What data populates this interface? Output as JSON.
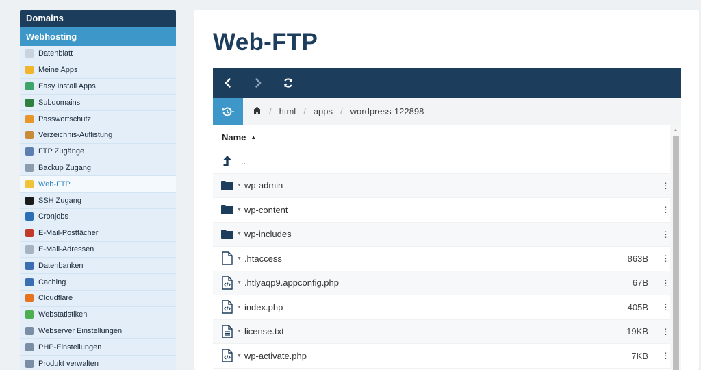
{
  "sidebar": {
    "header": "Domains",
    "section": "Webhosting",
    "items": [
      {
        "label": "Datenblatt",
        "icon": "document-icon",
        "color": "#c9d3de"
      },
      {
        "label": "Meine Apps",
        "icon": "apps-icon",
        "color": "#f0b52a"
      },
      {
        "label": "Easy Install Apps",
        "icon": "install-icon",
        "color": "#3da46a"
      },
      {
        "label": "Subdomains",
        "icon": "globe-icon",
        "color": "#2f7f3f"
      },
      {
        "label": "Passwortschutz",
        "icon": "key-icon",
        "color": "#e8962a"
      },
      {
        "label": "Verzeichnis-Auflistung",
        "icon": "folder-open-icon",
        "color": "#c98b3a"
      },
      {
        "label": "FTP Zugänge",
        "icon": "ftp-icon",
        "color": "#5a7fb0"
      },
      {
        "label": "Backup Zugang",
        "icon": "backup-icon",
        "color": "#8b9cb0"
      },
      {
        "label": "Web-FTP",
        "icon": "folder-icon",
        "color": "#f0c43a"
      },
      {
        "label": "SSH Zugang",
        "icon": "terminal-icon",
        "color": "#1a1a1a"
      },
      {
        "label": "Cronjobs",
        "icon": "clock-icon",
        "color": "#2a6fb5"
      },
      {
        "label": "E-Mail-Postfächer",
        "icon": "mailbox-icon",
        "color": "#c0392b"
      },
      {
        "label": "E-Mail-Adressen",
        "icon": "envelope-icon",
        "color": "#a6b3c2"
      },
      {
        "label": "Datenbanken",
        "icon": "database-icon",
        "color": "#3b6db3"
      },
      {
        "label": "Caching",
        "icon": "cache-icon",
        "color": "#3b6db3"
      },
      {
        "label": "Cloudflare",
        "icon": "cloudflare-icon",
        "color": "#e8731f"
      },
      {
        "label": "Webstatistiken",
        "icon": "chart-icon",
        "color": "#4caf50"
      },
      {
        "label": "Webserver Einstellungen",
        "icon": "gears-icon",
        "color": "#7a8fa6"
      },
      {
        "label": "PHP-Einstellungen",
        "icon": "gears-icon",
        "color": "#7a8fa6"
      },
      {
        "label": "Produkt verwalten",
        "icon": "gears-icon",
        "color": "#7a8fa6"
      }
    ],
    "active_index": 8
  },
  "main": {
    "title": "Web-FTP",
    "breadcrumb": [
      "html",
      "apps",
      "wordpress-122898"
    ],
    "column_name": "Name",
    "parent_label": "..",
    "rows": [
      {
        "type": "folder",
        "name": "wp-admin",
        "size": ""
      },
      {
        "type": "folder",
        "name": "wp-content",
        "size": ""
      },
      {
        "type": "folder",
        "name": "wp-includes",
        "size": ""
      },
      {
        "type": "file",
        "name": ".htaccess",
        "size": "863B"
      },
      {
        "type": "code",
        "name": ".htlyaqp9.appconfig.php",
        "size": "67B"
      },
      {
        "type": "code",
        "name": "index.php",
        "size": "405B"
      },
      {
        "type": "text",
        "name": "license.txt",
        "size": "19KB"
      },
      {
        "type": "code",
        "name": "wp-activate.php",
        "size": "7KB"
      }
    ]
  },
  "colors": {
    "navy": "#1d3d5c",
    "accent": "#3d97c9",
    "sidebar_bg": "#e3eef9"
  }
}
